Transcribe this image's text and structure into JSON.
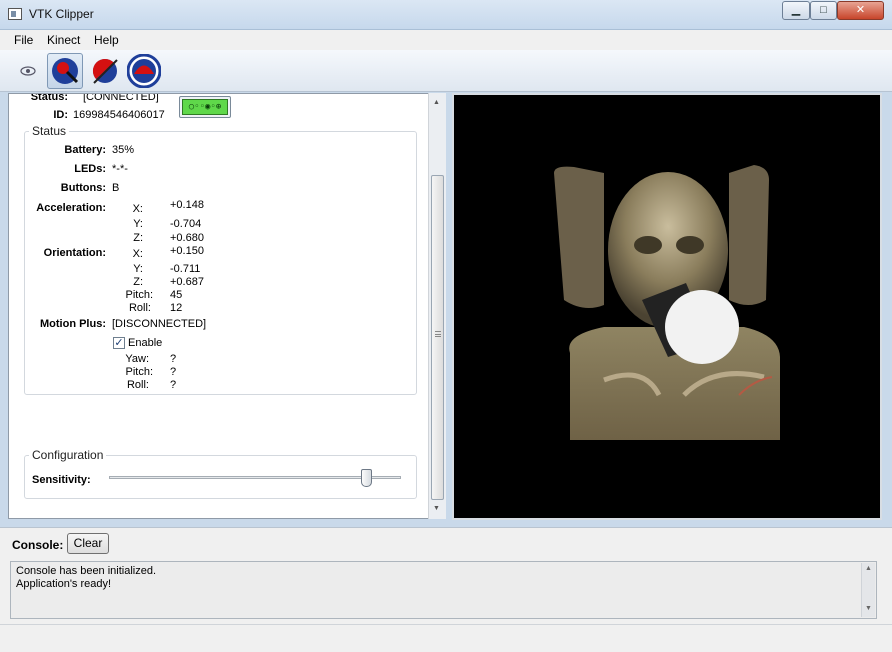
{
  "window": {
    "title": "VTK Clipper",
    "minimize": "▁",
    "maximize": "□",
    "close": "✕"
  },
  "menu": [
    {
      "label": "File"
    },
    {
      "label": "Kinect"
    },
    {
      "label": "Help"
    }
  ],
  "toolbar": {
    "icons": [
      "eye-icon",
      "sphere-with-pointer-icon",
      "sphere-with-slash-icon",
      "cap-icon"
    ]
  },
  "device": {
    "status_label": "Status:",
    "status_value": "[CONNECTED]",
    "id_label": "ID:",
    "id_value": "169984546406017",
    "wiimote_glyph": "○◦◦◉◦⊕"
  },
  "status_group": {
    "title": "Status",
    "battery_label": "Battery:",
    "battery_value": "35%",
    "leds_label": "LEDs:",
    "leds_value": "*-*-",
    "buttons_label": "Buttons:",
    "buttons_value": "B",
    "acceleration": {
      "label": "Acceleration:",
      "x_label": "X:",
      "x": "+0.148",
      "y_label": "Y:",
      "y": "-0.704",
      "z_label": "Z:",
      "z": "+0.680"
    },
    "orientation": {
      "label": "Orientation:",
      "x_label": "X:",
      "x": "+0.150",
      "y_label": "Y:",
      "y": "-0.711",
      "z_label": "Z:",
      "z": "+0.687",
      "pitch_label": "Pitch:",
      "pitch": "45",
      "roll_label": "Roll:",
      "roll": "12"
    },
    "motion_plus": {
      "label": "Motion Plus:",
      "value": "[DISCONNECTED]",
      "enable_label": "Enable",
      "enable_checked": true,
      "yaw_label": "Yaw:",
      "yaw": "?",
      "pitch_label": "Pitch:",
      "pitch": "?",
      "roll_label": "Roll:",
      "roll": "?"
    }
  },
  "configuration": {
    "title": "Configuration",
    "sensitivity_label": "Sensitivity:",
    "sensitivity_level": 0.88
  },
  "console": {
    "label": "Console:",
    "clear_button": "Clear",
    "lines": [
      "Console has been initialized.",
      "Application's ready!"
    ]
  },
  "colors": {
    "accent_blue": "#1f3f9a",
    "accent_red": "#d41111",
    "wiimote_green": "#5fd84a"
  }
}
